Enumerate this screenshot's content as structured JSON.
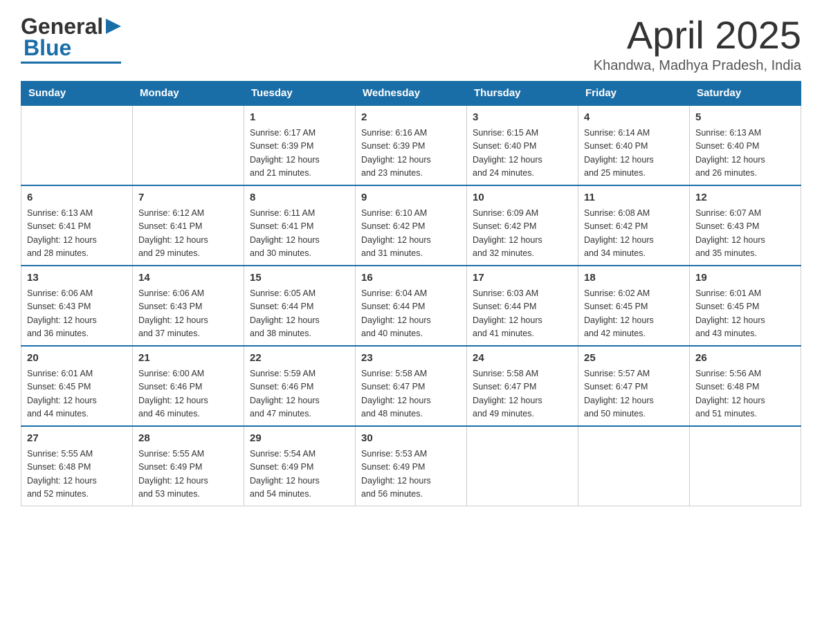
{
  "header": {
    "month_title": "April 2025",
    "location": "Khandwa, Madhya Pradesh, India",
    "logo_general": "General",
    "logo_blue": "Blue"
  },
  "weekdays": [
    "Sunday",
    "Monday",
    "Tuesday",
    "Wednesday",
    "Thursday",
    "Friday",
    "Saturday"
  ],
  "weeks": [
    {
      "days": [
        {
          "num": "",
          "info": ""
        },
        {
          "num": "",
          "info": ""
        },
        {
          "num": "1",
          "info": "Sunrise: 6:17 AM\nSunset: 6:39 PM\nDaylight: 12 hours\nand 21 minutes."
        },
        {
          "num": "2",
          "info": "Sunrise: 6:16 AM\nSunset: 6:39 PM\nDaylight: 12 hours\nand 23 minutes."
        },
        {
          "num": "3",
          "info": "Sunrise: 6:15 AM\nSunset: 6:40 PM\nDaylight: 12 hours\nand 24 minutes."
        },
        {
          "num": "4",
          "info": "Sunrise: 6:14 AM\nSunset: 6:40 PM\nDaylight: 12 hours\nand 25 minutes."
        },
        {
          "num": "5",
          "info": "Sunrise: 6:13 AM\nSunset: 6:40 PM\nDaylight: 12 hours\nand 26 minutes."
        }
      ]
    },
    {
      "days": [
        {
          "num": "6",
          "info": "Sunrise: 6:13 AM\nSunset: 6:41 PM\nDaylight: 12 hours\nand 28 minutes."
        },
        {
          "num": "7",
          "info": "Sunrise: 6:12 AM\nSunset: 6:41 PM\nDaylight: 12 hours\nand 29 minutes."
        },
        {
          "num": "8",
          "info": "Sunrise: 6:11 AM\nSunset: 6:41 PM\nDaylight: 12 hours\nand 30 minutes."
        },
        {
          "num": "9",
          "info": "Sunrise: 6:10 AM\nSunset: 6:42 PM\nDaylight: 12 hours\nand 31 minutes."
        },
        {
          "num": "10",
          "info": "Sunrise: 6:09 AM\nSunset: 6:42 PM\nDaylight: 12 hours\nand 32 minutes."
        },
        {
          "num": "11",
          "info": "Sunrise: 6:08 AM\nSunset: 6:42 PM\nDaylight: 12 hours\nand 34 minutes."
        },
        {
          "num": "12",
          "info": "Sunrise: 6:07 AM\nSunset: 6:43 PM\nDaylight: 12 hours\nand 35 minutes."
        }
      ]
    },
    {
      "days": [
        {
          "num": "13",
          "info": "Sunrise: 6:06 AM\nSunset: 6:43 PM\nDaylight: 12 hours\nand 36 minutes."
        },
        {
          "num": "14",
          "info": "Sunrise: 6:06 AM\nSunset: 6:43 PM\nDaylight: 12 hours\nand 37 minutes."
        },
        {
          "num": "15",
          "info": "Sunrise: 6:05 AM\nSunset: 6:44 PM\nDaylight: 12 hours\nand 38 minutes."
        },
        {
          "num": "16",
          "info": "Sunrise: 6:04 AM\nSunset: 6:44 PM\nDaylight: 12 hours\nand 40 minutes."
        },
        {
          "num": "17",
          "info": "Sunrise: 6:03 AM\nSunset: 6:44 PM\nDaylight: 12 hours\nand 41 minutes."
        },
        {
          "num": "18",
          "info": "Sunrise: 6:02 AM\nSunset: 6:45 PM\nDaylight: 12 hours\nand 42 minutes."
        },
        {
          "num": "19",
          "info": "Sunrise: 6:01 AM\nSunset: 6:45 PM\nDaylight: 12 hours\nand 43 minutes."
        }
      ]
    },
    {
      "days": [
        {
          "num": "20",
          "info": "Sunrise: 6:01 AM\nSunset: 6:45 PM\nDaylight: 12 hours\nand 44 minutes."
        },
        {
          "num": "21",
          "info": "Sunrise: 6:00 AM\nSunset: 6:46 PM\nDaylight: 12 hours\nand 46 minutes."
        },
        {
          "num": "22",
          "info": "Sunrise: 5:59 AM\nSunset: 6:46 PM\nDaylight: 12 hours\nand 47 minutes."
        },
        {
          "num": "23",
          "info": "Sunrise: 5:58 AM\nSunset: 6:47 PM\nDaylight: 12 hours\nand 48 minutes."
        },
        {
          "num": "24",
          "info": "Sunrise: 5:58 AM\nSunset: 6:47 PM\nDaylight: 12 hours\nand 49 minutes."
        },
        {
          "num": "25",
          "info": "Sunrise: 5:57 AM\nSunset: 6:47 PM\nDaylight: 12 hours\nand 50 minutes."
        },
        {
          "num": "26",
          "info": "Sunrise: 5:56 AM\nSunset: 6:48 PM\nDaylight: 12 hours\nand 51 minutes."
        }
      ]
    },
    {
      "days": [
        {
          "num": "27",
          "info": "Sunrise: 5:55 AM\nSunset: 6:48 PM\nDaylight: 12 hours\nand 52 minutes."
        },
        {
          "num": "28",
          "info": "Sunrise: 5:55 AM\nSunset: 6:49 PM\nDaylight: 12 hours\nand 53 minutes."
        },
        {
          "num": "29",
          "info": "Sunrise: 5:54 AM\nSunset: 6:49 PM\nDaylight: 12 hours\nand 54 minutes."
        },
        {
          "num": "30",
          "info": "Sunrise: 5:53 AM\nSunset: 6:49 PM\nDaylight: 12 hours\nand 56 minutes."
        },
        {
          "num": "",
          "info": ""
        },
        {
          "num": "",
          "info": ""
        },
        {
          "num": "",
          "info": ""
        }
      ]
    }
  ]
}
